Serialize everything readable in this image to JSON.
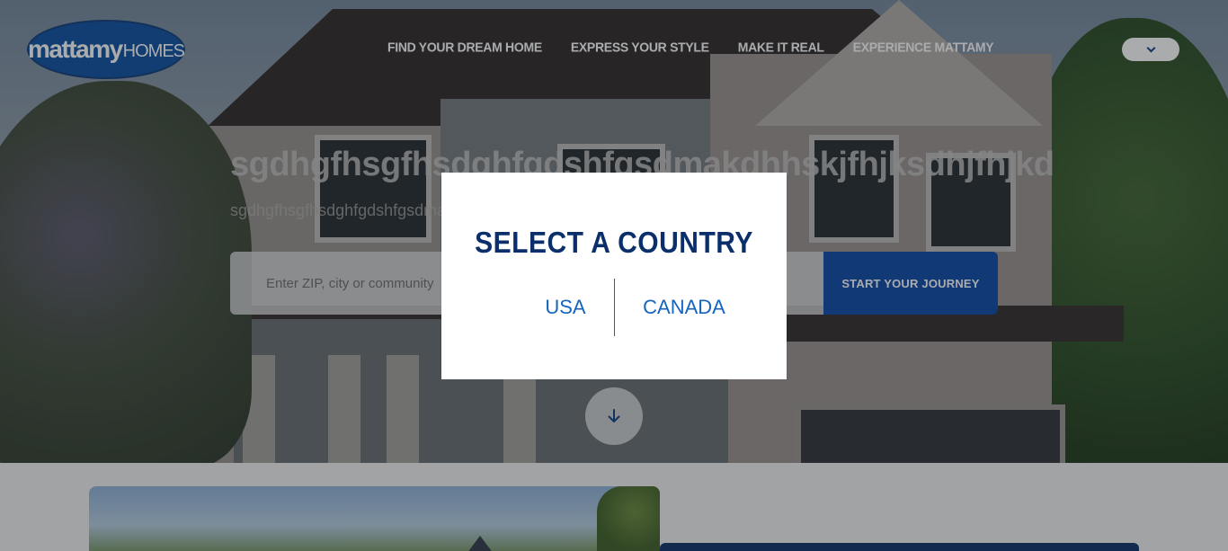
{
  "brand": {
    "name_bold": "mattamy",
    "name_light": "HOMES"
  },
  "nav": {
    "items": [
      {
        "label": "FIND YOUR DREAM HOME"
      },
      {
        "label": "EXPRESS YOUR STYLE"
      },
      {
        "label": "MAKE IT REAL"
      },
      {
        "label": "EXPERIENCE MATTAMY"
      }
    ],
    "language_toggle_icon": "chevron-down-icon"
  },
  "hero": {
    "title": "sgdhgfhsgfhsdghfgdshfgsdmakdhhskjfhjksdhjfhjkd",
    "subtitle": "sgdhgfhsgfhsdghfgdshfgsdmakdhhskjfhjksdhjfhjkdkqfrwnkewlrk",
    "search": {
      "placeholder": "Enter ZIP, city or community",
      "value": ""
    },
    "cta_label": "START YOUR JOURNEY",
    "scroll_icon": "arrow-down-icon"
  },
  "modal": {
    "title": "SELECT A COUNTRY",
    "options": [
      {
        "label": "USA"
      },
      {
        "label": "CANADA"
      }
    ]
  },
  "colors": {
    "brand_blue": "#0b47a6",
    "navy": "#0b2f6b",
    "link_blue": "#1565c0"
  }
}
